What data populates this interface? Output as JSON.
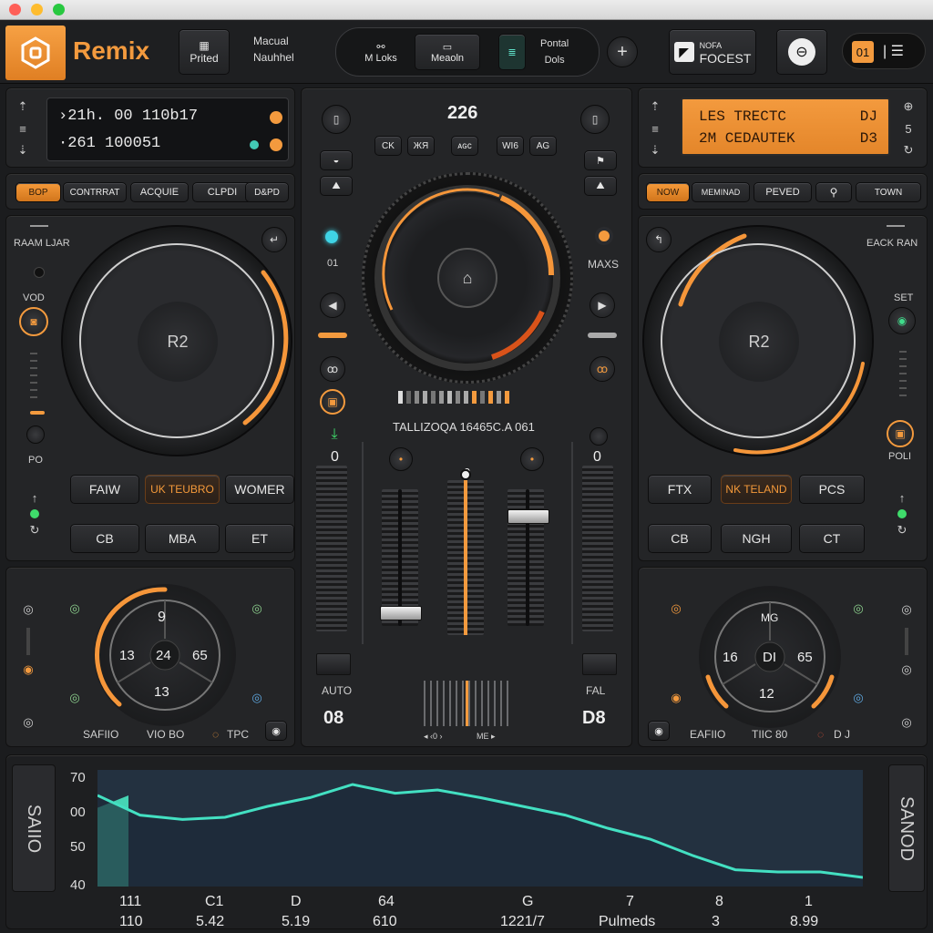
{
  "window": {
    "controls": [
      "close",
      "minimize",
      "maximize"
    ]
  },
  "header": {
    "app_name": "Remix",
    "printed_btn": {
      "icon": "grid-icon",
      "label": "Prited"
    },
    "manual_top": "Macual",
    "manual_bottom": "Nauhhel",
    "center_group": [
      {
        "icon": "link-icon",
        "label": "M Loks"
      },
      {
        "icon": "monitor-icon",
        "label": "Meaoln"
      },
      {
        "icon": "level-icon",
        "label": ""
      },
      {
        "label_top": "Pontal",
        "label_bottom": "Dols"
      }
    ],
    "add_label": "+",
    "forest_small": "NOFA",
    "forest_label": "FOCEST",
    "badge_num": "01"
  },
  "deck_left": {
    "lcd_line1": "›21h. 00 110b17",
    "lcd_line2": "·261 100051",
    "tabs": [
      "BOP",
      "CONTRRAT",
      "ACQUIE",
      "CLPDI",
      "D&PD"
    ],
    "label_top": "RAAM LJAR",
    "label_vod": "VOD",
    "label_po": "PO",
    "jog_center": "R2",
    "pads_row1": [
      "FAIW",
      "UK TEUBRO",
      "WOMER"
    ],
    "pads_row2": [
      "CB",
      "MBA",
      "ET"
    ],
    "knob_top": "9",
    "knob_left": "13",
    "knob_center": "24",
    "knob_right": "65",
    "knob_bottom": "13",
    "bottom_labels": [
      "SAFIIO",
      "VIO BO",
      "TPC"
    ]
  },
  "mixer": {
    "bpm": "226",
    "buttons": [
      "CK",
      "ЖЯ",
      "ᴀɢᴄ",
      "WI6",
      "AG"
    ],
    "label_01": "01",
    "label_maxs": "MAXS",
    "ticker": "TALLIZOQA 16465C.A 061",
    "ch_left_val": "0",
    "ch_right_val": "0",
    "center_val": "0",
    "auto_label": "AUTO",
    "left_num": "08",
    "fal_label": "FAL",
    "right_num": "D8",
    "foot_left": "◂ ‹0 ›",
    "foot_right": "ME ▸",
    "accent_cyan": "#3fd4e6",
    "accent_orange": "#f5963a"
  },
  "deck_right": {
    "lcd_line1": "LES TRECTC",
    "lcd_line1_right": "DJ",
    "lcd_line2": "2M CEDAUTEK",
    "lcd_line2_right": "D3",
    "tabs": [
      "NOW",
      "MEMINAD",
      "PEVED",
      "⚲",
      "TOWN"
    ],
    "label_top": "EACK RAN",
    "label_set": "SET",
    "label_poli": "POLI",
    "jog_center": "R2",
    "pads_row1": [
      "FTX",
      "NK TELAND",
      "PCS"
    ],
    "pads_row2": [
      "CB",
      "NGH",
      "CT"
    ],
    "knob_top": "MG",
    "knob_left": "16",
    "knob_center": "DI",
    "knob_right": "65",
    "knob_bottom": "12",
    "bottom_labels": [
      "EAFIIO",
      "TIIC 80",
      "D J"
    ]
  },
  "waveform": {
    "side_left": "SAIIO",
    "side_right": "SANOD",
    "y_ticks": [
      "70",
      "00",
      "50",
      "40"
    ],
    "x_row1": [
      "111",
      "C1",
      "D",
      "64",
      "G",
      "7",
      "8",
      "1"
    ],
    "x_row2": [
      "110",
      "5.42",
      "5.19",
      "610",
      "1221/7",
      "Pulmeds",
      "3",
      "8.99"
    ],
    "line_color": "#43e0c2"
  },
  "chart_data": {
    "type": "area",
    "yticks": [
      "70",
      "00",
      "50",
      "40"
    ],
    "values": [
      0.8,
      0.62,
      0.58,
      0.6,
      0.7,
      0.78,
      0.9,
      0.82,
      0.85,
      0.78,
      0.7,
      0.62,
      0.5,
      0.4,
      0.25,
      0.12,
      0.1,
      0.1,
      0.05
    ]
  }
}
